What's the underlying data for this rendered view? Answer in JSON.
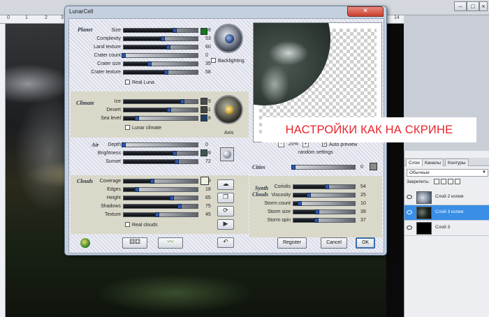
{
  "ruler_ticks": [
    {
      "label": "0"
    },
    {
      "label": "1"
    },
    {
      "label": "2"
    },
    {
      "label": "3"
    },
    {
      "label": "14"
    }
  ],
  "dialog": {
    "title": "LunarCell",
    "close_label": "✕",
    "planet": {
      "title": "Planet",
      "sliders": [
        {
          "label": "Size",
          "value": "69",
          "fraction": 0.69
        },
        {
          "label": "Complexity",
          "value": "53",
          "fraction": 0.53
        },
        {
          "label": "Land texture",
          "value": "60",
          "fraction": 0.6
        },
        {
          "label": "Crater count",
          "value": "0",
          "fraction": 0.0
        },
        {
          "label": "Crater size",
          "value": "35",
          "fraction": 0.35
        },
        {
          "label": "Crater texture",
          "value": "58",
          "fraction": 0.58
        }
      ],
      "real_luna_label": "Real Luna",
      "backlighting_label": "Backlighting",
      "swatch_color": "#0f7a1a"
    },
    "climate": {
      "title": "Climate",
      "sliders": [
        {
          "label": "Ice",
          "value": "79",
          "fraction": 0.79
        },
        {
          "label": "Desert",
          "value": "61",
          "fraction": 0.61
        },
        {
          "label": "Sea level",
          "value": "18",
          "fraction": 0.18
        }
      ],
      "lunar_climate_label": "Lunar climate",
      "axis_label": "Axis",
      "swatch_colors": [
        "#4a4a4a",
        "#3f4542",
        "#1f3f66"
      ]
    },
    "air": {
      "title": "Air",
      "sliders": [
        {
          "label": "Depth",
          "value": "0",
          "fraction": 0.0
        },
        {
          "label": "Brightness",
          "value": "69",
          "fraction": 0.69
        },
        {
          "label": "Sunset",
          "value": "72",
          "fraction": 0.72
        }
      ],
      "swatch_color": "#3b5850"
    },
    "clouds": {
      "title": "Clouds",
      "sliders": [
        {
          "label": "Coverage",
          "value": "39",
          "fraction": 0.39
        },
        {
          "label": "Edges",
          "value": "18",
          "fraction": 0.18
        },
        {
          "label": "Height",
          "value": "65",
          "fraction": 0.65
        },
        {
          "label": "Shadows",
          "value": "75",
          "fraction": 0.75
        },
        {
          "label": "Texture",
          "value": "45",
          "fraction": 0.45
        }
      ],
      "real_clouds_label": "Real clouds",
      "swatch_color": "#eef0e2"
    },
    "preview": {
      "zoom": "25%",
      "zoom_plus": "+",
      "zoom_minus": "-",
      "auto_preview_label": "Auto preview",
      "random_settings_label": "random settings"
    },
    "cities": {
      "title": "Cities",
      "value": "0",
      "fraction": 0.0,
      "swatch_color": "#8a8a86"
    },
    "synth_clouds": {
      "title_line1": "Synth",
      "title_line2": "Clouds",
      "sliders": [
        {
          "label": "Coriolis",
          "value": "54",
          "fraction": 0.54
        },
        {
          "label": "Viscosity",
          "value": "25",
          "fraction": 0.25
        },
        {
          "label": "Storm count",
          "value": "10",
          "fraction": 0.1
        },
        {
          "label": "Storm size",
          "value": "39",
          "fraction": 0.39
        },
        {
          "label": "Storm spin",
          "value": "37",
          "fraction": 0.37
        }
      ]
    },
    "buttons": {
      "register": "Register",
      "cancel": "Cancel",
      "ok": "OK"
    }
  },
  "overlay_text": "НАСТРОЙКИ КАК НА СКРИНЕ",
  "layers_panel": {
    "tabs": [
      "Слои",
      "Каналы",
      "Контуры"
    ],
    "blend_mode": "Обычные",
    "lock_label": "Закрепить:",
    "layers": [
      {
        "name": "Слой 2 копия",
        "selected": false
      },
      {
        "name": "Слой 3 копия",
        "selected": true
      },
      {
        "name": "Слой 3",
        "selected": false
      }
    ]
  }
}
